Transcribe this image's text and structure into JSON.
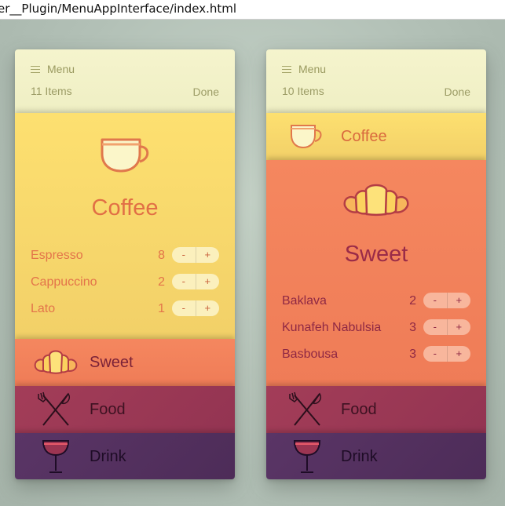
{
  "browser": {
    "url_fragment": "er__Plugin/MenuAppInterface/index.html"
  },
  "phones": [
    {
      "header": {
        "menu_label": "Menu",
        "count_label": "11 Items",
        "done_label": "Done"
      },
      "coffee": {
        "title": "Coffee",
        "items": [
          {
            "name": "Espresso",
            "qty": "8",
            "minus": "-",
            "plus": "+"
          },
          {
            "name": "Cappuccino",
            "qty": "2",
            "minus": "-",
            "plus": "+"
          },
          {
            "name": "Lato",
            "qty": "1",
            "minus": "-",
            "plus": "+"
          }
        ]
      },
      "sweet": {
        "title": "Sweet"
      },
      "food": {
        "title": "Food"
      },
      "drink": {
        "title": "Drink"
      }
    },
    {
      "header": {
        "menu_label": "Menu",
        "count_label": "10 Items",
        "done_label": "Done"
      },
      "coffee": {
        "title": "Coffee"
      },
      "sweet": {
        "title": "Sweet",
        "items": [
          {
            "name": "Baklava",
            "qty": "2",
            "minus": "-",
            "plus": "+"
          },
          {
            "name": "Kunafeh Nabulsia",
            "qty": "3",
            "minus": "-",
            "plus": "+"
          },
          {
            "name": "Basbousa",
            "qty": "3",
            "minus": "-",
            "plus": "+"
          }
        ]
      },
      "food": {
        "title": "Food"
      },
      "drink": {
        "title": "Drink"
      }
    }
  ],
  "colors": {
    "header": "#f2f1c7",
    "coffee": "#f8d96c",
    "sweet": "#f2825b",
    "food": "#9c3955",
    "drink": "#55315f"
  },
  "icons": {
    "coffee": "coffee-cup-icon",
    "sweet": "croissant-icon",
    "food": "fork-knife-icon",
    "drink": "cocktail-glass-icon"
  }
}
